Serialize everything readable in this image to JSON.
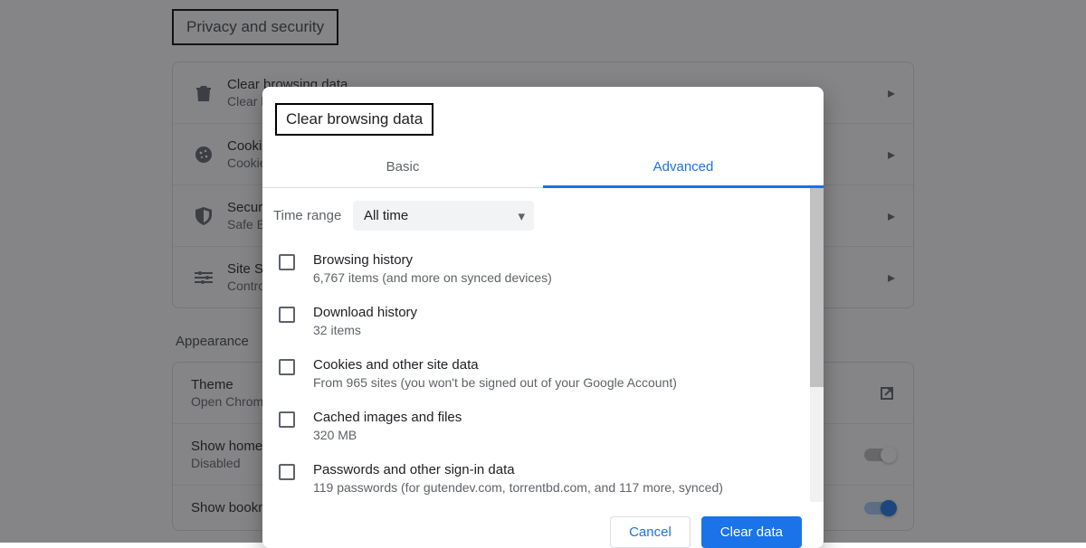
{
  "page": {
    "section_title": "Privacy and security",
    "rows": [
      {
        "icon": "trash",
        "title": "Clear browsing data",
        "sub": "Clear history, cookies, cache, and more"
      },
      {
        "icon": "cookie",
        "title": "Cookies and other site data",
        "sub": "Cookies are allowed"
      },
      {
        "icon": "shield",
        "title": "Security",
        "sub": "Safe Browsing"
      },
      {
        "icon": "sliders",
        "title": "Site Settings",
        "sub": "Controls what information sites can use"
      }
    ],
    "appearance_title": "Appearance",
    "appearance_rows": [
      {
        "title": "Theme",
        "sub": "Open Chrome Web Store",
        "right": "launch"
      },
      {
        "title": "Show home button",
        "sub": "Disabled",
        "right": "toggle_off"
      },
      {
        "title": "Show bookmarks bar",
        "sub": "",
        "right": "toggle_on"
      }
    ]
  },
  "dialog": {
    "title": "Clear browsing data",
    "tabs": {
      "basic": "Basic",
      "advanced": "Advanced"
    },
    "active_tab": "advanced",
    "time_range_label": "Time range",
    "time_range_value": "All time",
    "options": [
      {
        "title": "Browsing history",
        "sub": "6,767 items (and more on synced devices)"
      },
      {
        "title": "Download history",
        "sub": "32 items"
      },
      {
        "title": "Cookies and other site data",
        "sub": "From 965 sites (you won't be signed out of your Google Account)"
      },
      {
        "title": "Cached images and files",
        "sub": "320 MB"
      },
      {
        "title": "Passwords and other sign-in data",
        "sub": "119 passwords (for gutendev.com, torrentbd.com, and 117 more, synced)"
      }
    ],
    "buttons": {
      "cancel": "Cancel",
      "clear": "Clear data"
    }
  }
}
